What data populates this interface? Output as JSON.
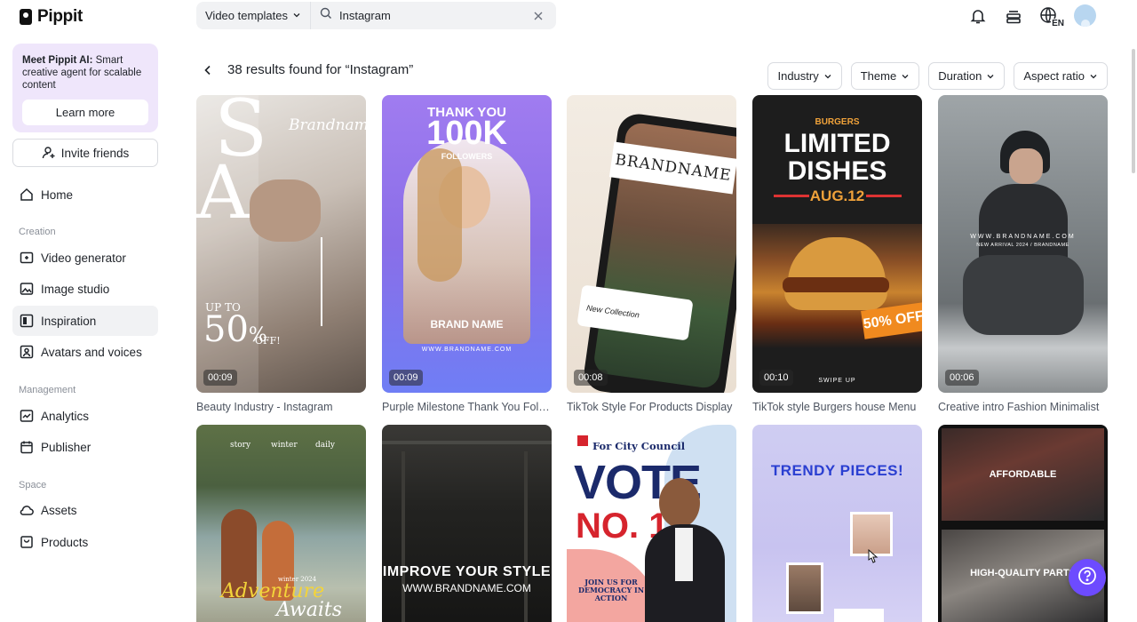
{
  "app": {
    "name": "Pippit"
  },
  "sidebar": {
    "promo": {
      "title": "Meet Pippit AI:",
      "body": "Smart creative agent for scalable content",
      "button": "Learn more"
    },
    "invite_label": "Invite friends",
    "home": "Home",
    "sections": {
      "creation": "Creation",
      "management": "Management",
      "space": "Space"
    },
    "creation_items": [
      "Video generator",
      "Image studio",
      "Inspiration",
      "Avatars and voices"
    ],
    "management_items": [
      "Analytics",
      "Publisher"
    ],
    "space_items": [
      "Assets",
      "Products"
    ]
  },
  "search": {
    "category": "Video templates",
    "query": "Instagram",
    "placeholder": "Search"
  },
  "header": {
    "language": "EN"
  },
  "results": {
    "title": "38 results found for “Instagram”",
    "filters": [
      "Industry",
      "Theme",
      "Duration",
      "Aspect ratio"
    ]
  },
  "cards": [
    {
      "title": "Beauty Industry - Instagram",
      "duration": "00:09",
      "overlay": {
        "brand": "Brandname",
        "upto": "UP TO",
        "pct": "50",
        "pct_sign": "%",
        "off": "OFF!"
      }
    },
    {
      "title": "Purple Milestone Thank You Followers",
      "duration": "00:09",
      "overlay": {
        "line1": "THANK YOU",
        "line2": "100K",
        "line3": "FOLLOWERS",
        "brand": "BRAND NAME",
        "url": "WWW.BRANDNAME.COM"
      }
    },
    {
      "title": "TikTok Style For Products Display",
      "duration": "00:08",
      "overlay": {
        "brand": "BRANDNAME",
        "caption": "New Collection"
      }
    },
    {
      "title": "TikTok style Burgers house Menu",
      "duration": "00:10",
      "overlay": {
        "kicker": "BURGERS",
        "line1": "LIMITED",
        "line2": "DISHES",
        "date": "AUG.12",
        "promo": "50% OFF",
        "swipe": "SWIPE UP"
      }
    },
    {
      "title": "Creative intro Fashion Minimalist",
      "duration": "00:06",
      "overlay": {
        "url": "WWW.BRANDNAME.COM",
        "sub": "NEW ARRIVAL 2024 / BRANDNAME"
      }
    },
    {
      "title": "",
      "overlay": {
        "tags": [
          "story",
          "winter",
          "daily"
        ],
        "year": "winter 2024",
        "line1": "Adventure",
        "line2": "Awaits"
      }
    },
    {
      "title": "",
      "overlay": {
        "line1": "IMPROVE YOUR STYLE",
        "url": "WWW.BRANDNAME.COM"
      }
    },
    {
      "title": "",
      "overlay": {
        "kicker": "For City Council",
        "line1": "VOTE",
        "line2": "NO. 1",
        "foot": "JOIN US FOR DEMOCRACY IN ACTION"
      }
    },
    {
      "title": "",
      "overlay": {
        "line1": "TRENDY PIECES!"
      }
    },
    {
      "title": "",
      "overlay": {
        "line1": "AFFORDABLE",
        "line2": "HIGH-QUALITY PARTS"
      }
    }
  ]
}
